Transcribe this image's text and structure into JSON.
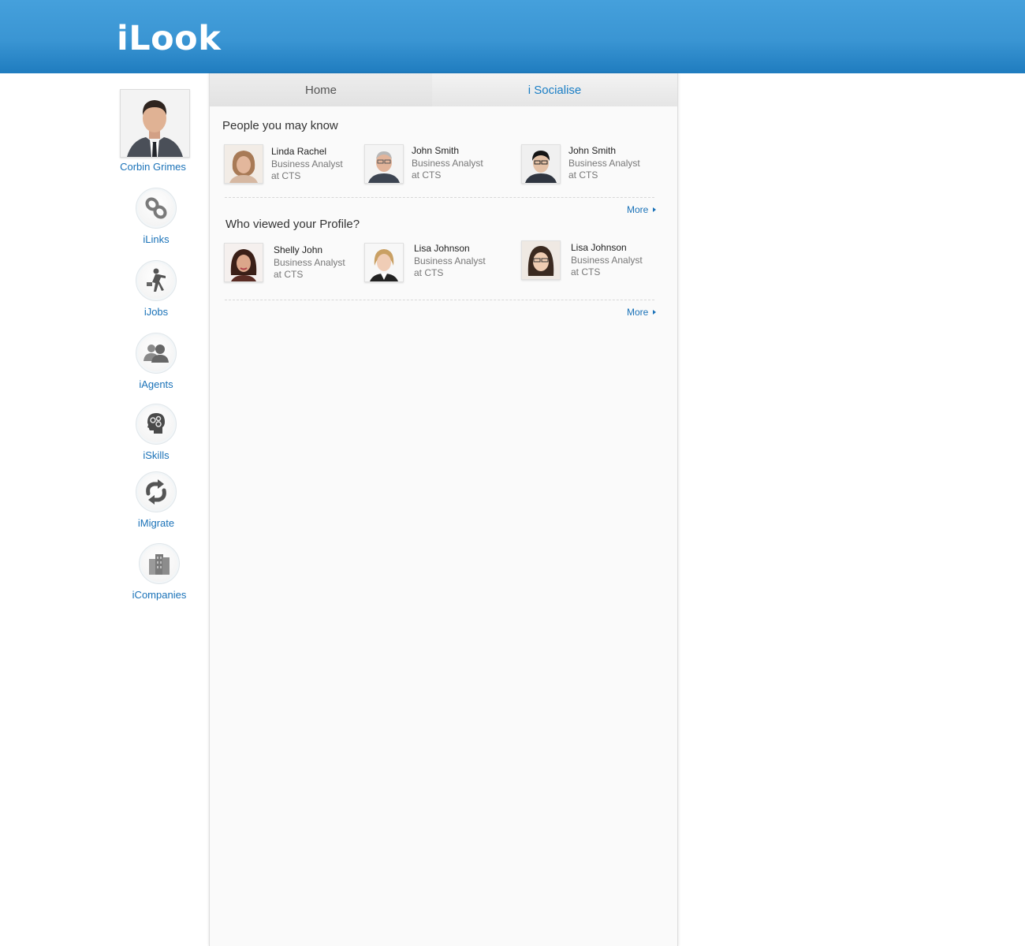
{
  "app": {
    "logo": "iLook"
  },
  "user": {
    "name": "Corbin Grimes",
    "avatar_icon": "user-photo"
  },
  "sidebar": {
    "items": [
      {
        "label": "iLinks",
        "icon": "chain-links-icon"
      },
      {
        "label": "iJobs",
        "icon": "walking-businessman-icon"
      },
      {
        "label": "iAgents",
        "icon": "people-icon"
      },
      {
        "label": "iSkills",
        "icon": "brain-gears-icon"
      },
      {
        "label": "iMigrate",
        "icon": "refresh-arrows-icon"
      },
      {
        "label": "iCompanies",
        "icon": "buildings-icon"
      }
    ]
  },
  "tabs": [
    {
      "label": "Home",
      "active": false
    },
    {
      "label": "i Socialise",
      "active": true
    }
  ],
  "sections": [
    {
      "title": "People you may know",
      "more_label": "More",
      "people": [
        {
          "name": "Linda Rachel",
          "role": "Business Analyst",
          "company": "at CTS"
        },
        {
          "name": "John Smith",
          "role": "Business Analyst",
          "company": "at CTS"
        },
        {
          "name": "John Smith",
          "role": "Business Analyst",
          "company": "at CTS"
        }
      ]
    },
    {
      "title": "Who viewed your Profile?",
      "more_label": "More",
      "people": [
        {
          "name": "Shelly John",
          "role": "Business Analyst",
          "company": "at CTS"
        },
        {
          "name": "Lisa Johnson",
          "role": "Business Analyst",
          "company": "at CTS"
        },
        {
          "name": "Lisa Johnson",
          "role": "Business Analyst",
          "company": "at CTS"
        }
      ]
    }
  ],
  "colors": {
    "header": "#3a95d3",
    "link": "#1a72b8",
    "active_tab_text": "#1a7ec5"
  }
}
